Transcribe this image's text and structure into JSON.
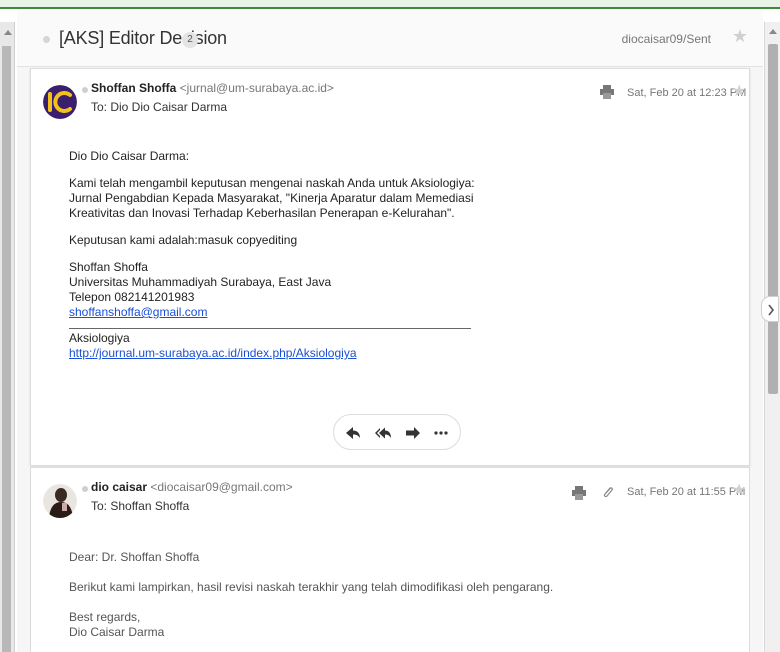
{
  "thread": {
    "subject": "[AKS] Editor Decision",
    "count": "2",
    "folder": "diocaisar09/Sent"
  },
  "messages": [
    {
      "sender_name": "Shoffan Shoffa",
      "sender_email": "<jurnal@um-surabaya.ac.id>",
      "to": "To: Dio Dio Caisar Darma",
      "date": "Sat, Feb 20 at 12:23 PM",
      "avatar_text": "IC",
      "greeting": "Dio Dio Caisar Darma:",
      "para1_line1": "Kami telah mengambil keputusan mengenai naskah Anda untuk Aksiologiya:",
      "para1_line2": "Jurnal Pengabdian Kepada Masyarakat, \"Kinerja Aparatur dalam Memediasi",
      "para1_line3": "Kreativitas dan Inovasi Terhadap Keberhasilan Penerapan e-Kelurahan\".",
      "decision": "Keputusan kami adalah:masuk copyediting",
      "sig_name": "Shoffan Shoffa",
      "sig_affiliation": "Universitas Muhammadiyah Surabaya, East Java",
      "sig_phone": "Telepon 082141201983",
      "sig_email": "shoffanshoffa@gmail.com",
      "journal_name": "Aksiologiya",
      "journal_url": "http://journal.um-surabaya.ac.id/index.php/Aksiologiya"
    },
    {
      "sender_name": "dio caisar",
      "sender_email": "<diocaisar09@gmail.com>",
      "to": "To: Shoffan Shoffa",
      "date": "Sat, Feb 20 at 11:55 PM",
      "greeting": "Dear: Dr. Shoffan Shoffa",
      "line1": "Berikut kami lampirkan, hasil revisi naskah terakhir yang telah dimodifikasi oleh pengarang.",
      "closing": "Best regards,",
      "signature": "Dio Caisar Darma"
    }
  ],
  "icons": {
    "star": "star-icon",
    "print": "print-icon",
    "attachment": "paperclip-icon",
    "reply": "reply-icon",
    "reply_all": "reply-all-icon",
    "forward": "forward-icon",
    "more": "more-icon"
  },
  "colors": {
    "accent_green": "#3c8a3c",
    "link": "#1a4fd6",
    "avatar_bg": "#3a1f6e",
    "avatar_fg": "#f2c21a"
  }
}
